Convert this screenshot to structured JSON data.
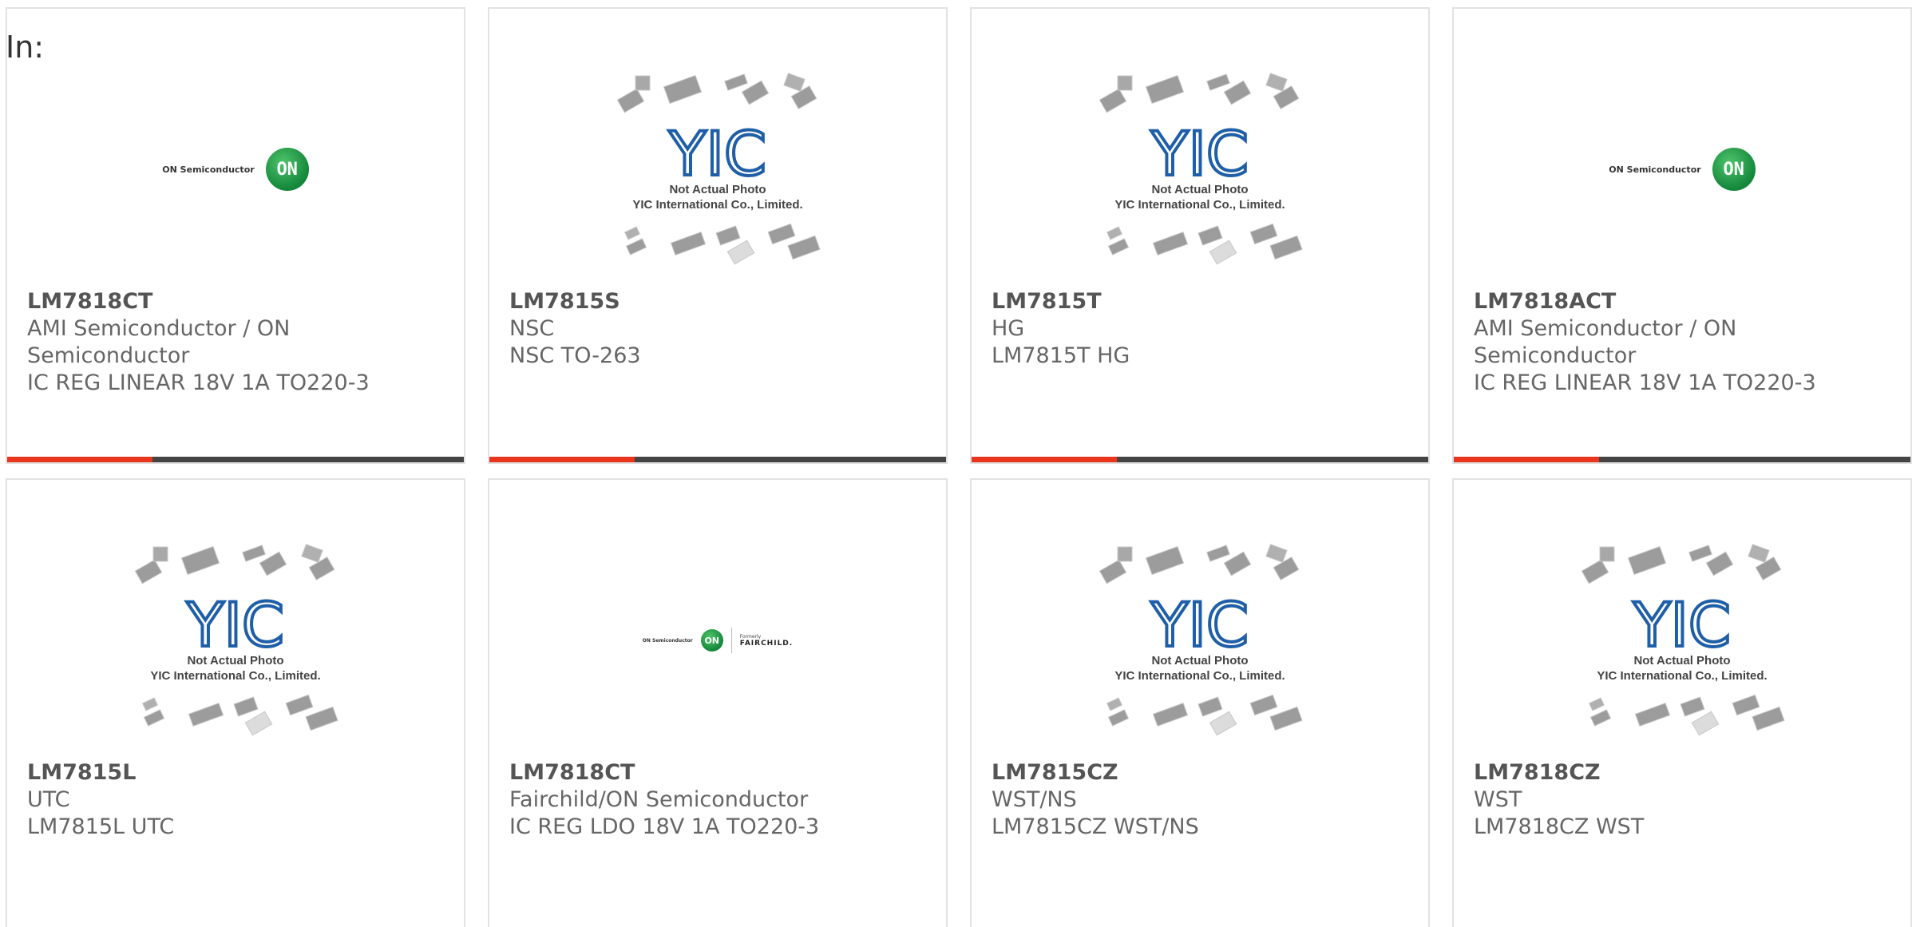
{
  "in_label": "In:",
  "colors": {
    "accent_red": "#e8351c",
    "bar_dark": "#444444",
    "text_gray": "#666666",
    "yic_blue": "#1f5fa8"
  },
  "placeholder": {
    "line1": "Not Actual Photo",
    "line2": "YIC International Co., Limited."
  },
  "brand_logos": {
    "on_semi_text": "ON Semiconductor",
    "on_badge": "ON",
    "fairchild_formerly": "Formerly",
    "fairchild_name": "FAIRCHILD."
  },
  "products": [
    {
      "part": "LM7818CT",
      "manufacturer": "AMI Semiconductor / ON Semiconductor",
      "description": "IC REG LINEAR 18V 1A TO220-3",
      "image": "on-semi-logo"
    },
    {
      "part": "LM7815S",
      "manufacturer": "NSC",
      "description": "NSC TO-263",
      "image": "yic-placeholder"
    },
    {
      "part": "LM7815T",
      "manufacturer": "HG",
      "description": "LM7815T HG",
      "image": "yic-placeholder"
    },
    {
      "part": "LM7818ACT",
      "manufacturer": "AMI Semiconductor / ON Semiconductor",
      "description": "IC REG LINEAR 18V 1A TO220-3",
      "image": "on-semi-logo"
    },
    {
      "part": "LM7815L",
      "manufacturer": "UTC",
      "description": "LM7815L UTC",
      "image": "yic-placeholder"
    },
    {
      "part": "LM7818CT",
      "manufacturer": "Fairchild/ON Semiconductor",
      "description": "IC REG LDO 18V 1A TO220-3",
      "image": "fairchild-logo"
    },
    {
      "part": "LM7815CZ",
      "manufacturer": "WST/NS",
      "description": "LM7815CZ WST/NS",
      "image": "yic-placeholder"
    },
    {
      "part": "LM7818CZ",
      "manufacturer": "WST",
      "description": "LM7818CZ WST",
      "image": "yic-placeholder"
    }
  ]
}
